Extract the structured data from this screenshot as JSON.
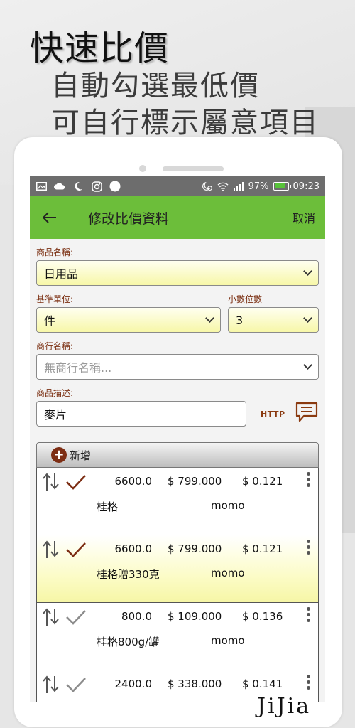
{
  "promo": {
    "headline": "快速比價",
    "line1": "自動勾選最低價",
    "line2": "可自行標示屬意項目"
  },
  "statusbar": {
    "battery": "97%",
    "time": "09:23"
  },
  "appbar": {
    "title": "修改比價資料",
    "action": "取消"
  },
  "form": {
    "product_label": "商品名稱:",
    "product_value": "日用品",
    "unit_label": "基準單位:",
    "unit_value": "件",
    "decimal_label": "小數位數",
    "decimal_value": "3",
    "store_label": "商行名稱:",
    "store_placeholder": "無商行名稱...",
    "desc_label": "商品描述:",
    "desc_value": "麥片",
    "http_label": "HTTP"
  },
  "list": {
    "add_label": "新增",
    "items": [
      {
        "qty": "6600.0",
        "price": "$ 799.000",
        "unit_price": "$ 0.121",
        "name": "桂格",
        "store": "momo",
        "checked": true,
        "highlight": false
      },
      {
        "qty": "6600.0",
        "price": "$ 799.000",
        "unit_price": "$ 0.121",
        "name": "桂格贈330克",
        "store": "momo",
        "checked": true,
        "highlight": true
      },
      {
        "qty": "800.0",
        "price": "$ 109.000",
        "unit_price": "$ 0.136",
        "name": "桂格800g/罐",
        "store": "momo",
        "checked": false,
        "highlight": false
      },
      {
        "qty": "2400.0",
        "price": "$ 338.000",
        "unit_price": "$ 0.141",
        "name": "",
        "store": "",
        "checked": false,
        "highlight": false
      }
    ]
  },
  "brand": "JiJia",
  "colors": {
    "appbar": "#6cbe3a",
    "label": "#7a2e10",
    "check_active": "#7d2e14",
    "check_inactive": "#8c8c8c",
    "highlight": "#f6f6a6"
  }
}
